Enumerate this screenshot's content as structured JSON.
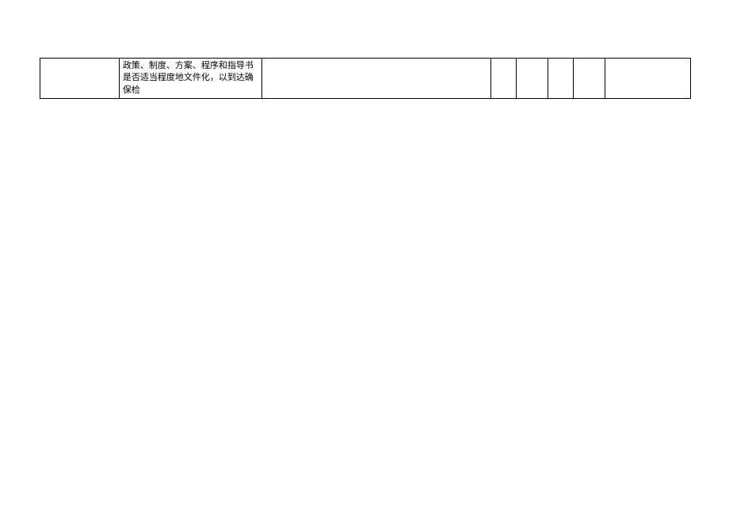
{
  "table": {
    "rows": [
      {
        "col1": "",
        "col2": "  政策、制度、方案、程序和指导书是否适当程度地文件化，以到达确保检",
        "col3": "",
        "col4": "",
        "col5": "",
        "col6": "",
        "col7": "",
        "col8": ""
      }
    ]
  }
}
